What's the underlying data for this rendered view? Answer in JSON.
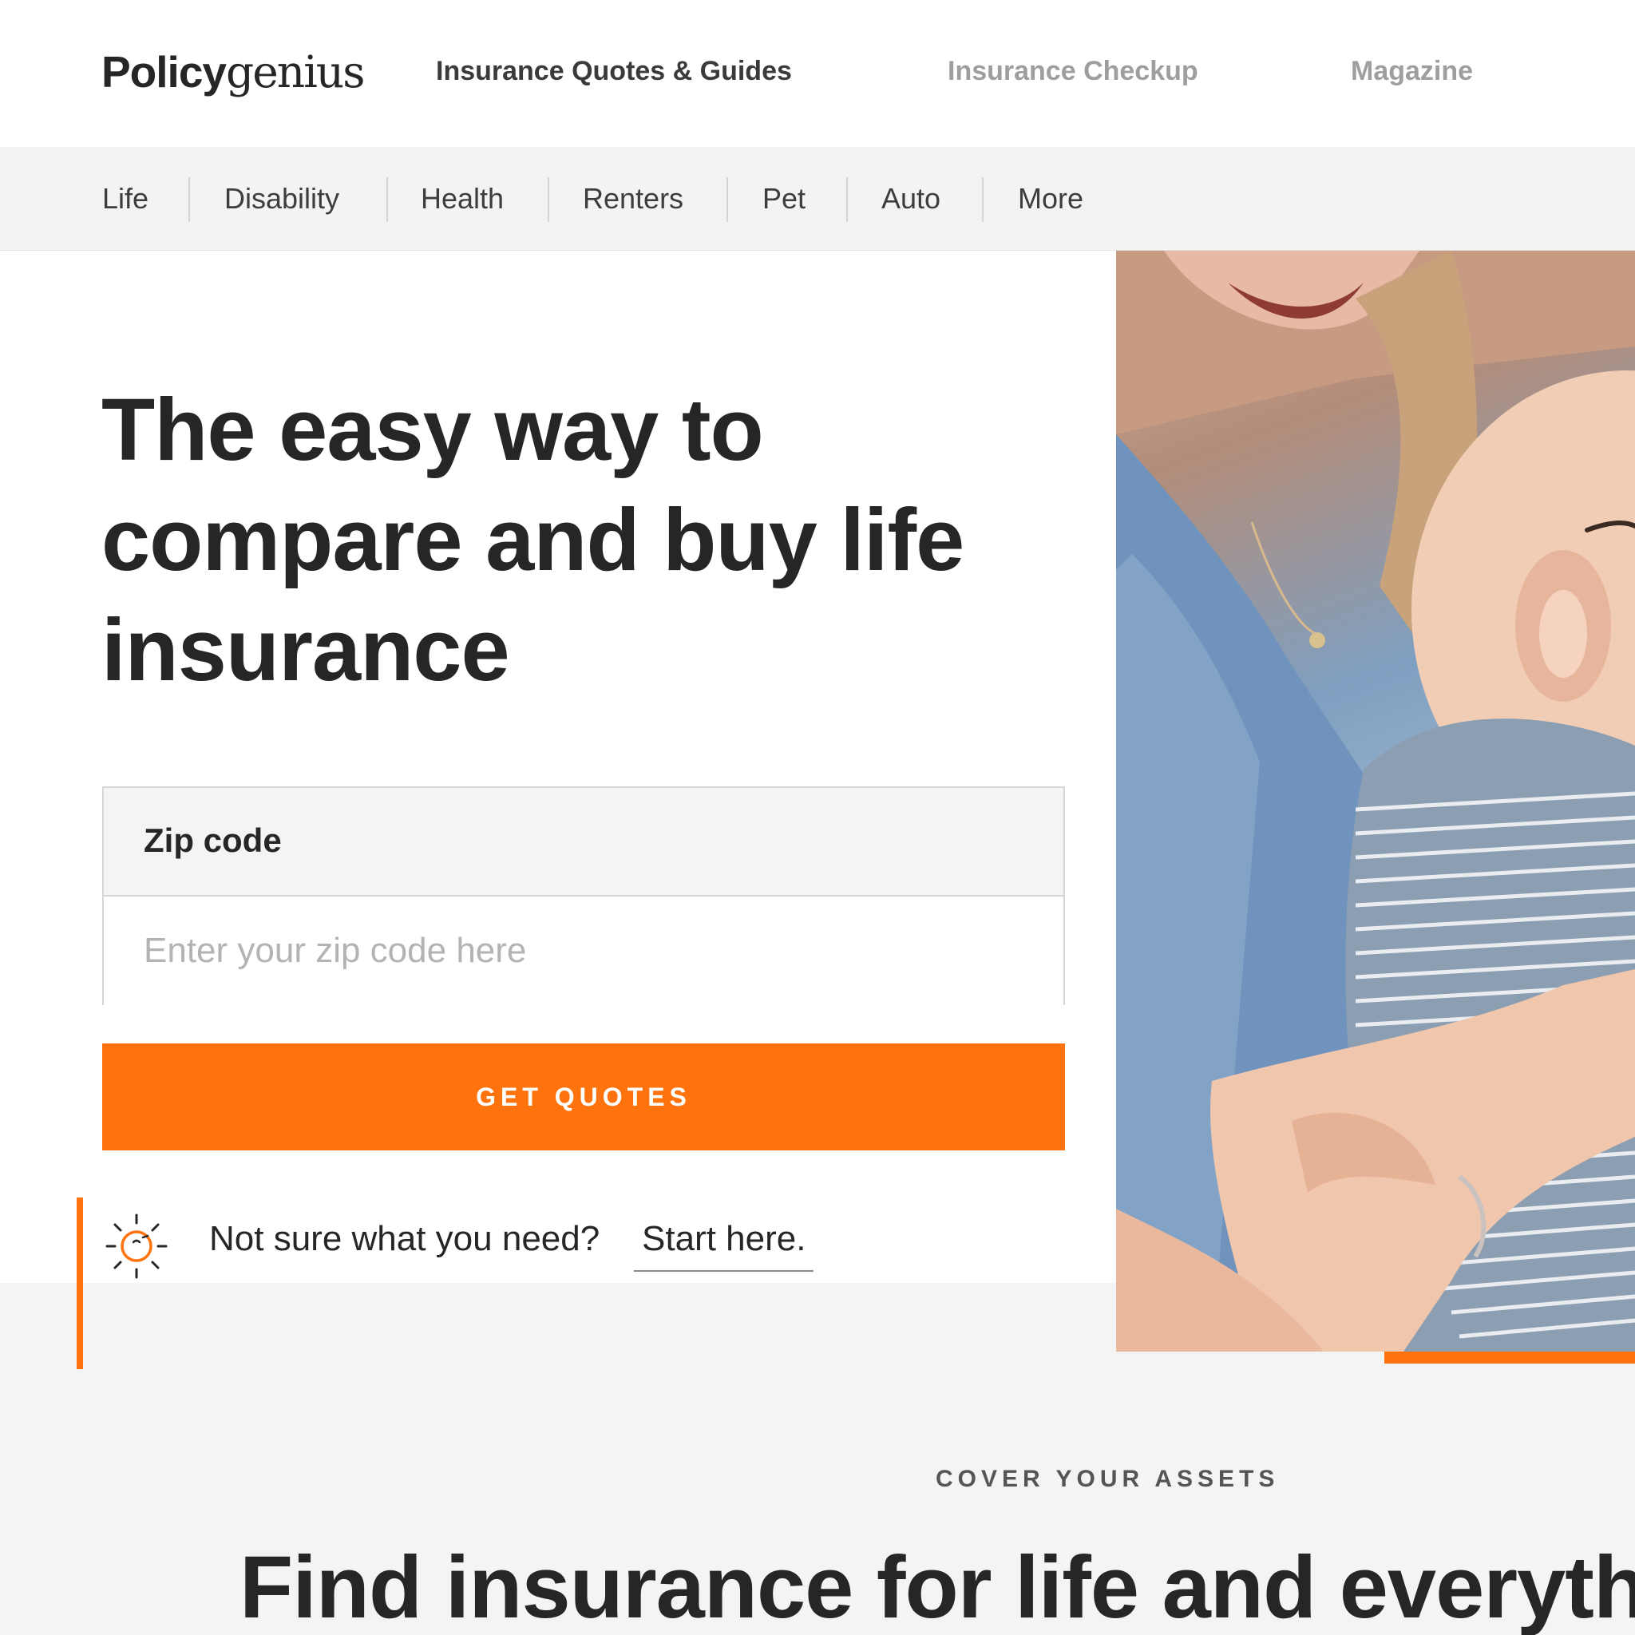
{
  "header": {
    "logo": {
      "bold": "Policy",
      "light": "genius"
    },
    "nav": [
      {
        "label": "Insurance Quotes & Guides",
        "active": true
      },
      {
        "label": "Insurance Checkup",
        "active": false
      },
      {
        "label": "Magazine",
        "active": false
      }
    ]
  },
  "subnav": {
    "items": [
      {
        "label": "Life"
      },
      {
        "label": "Disability"
      },
      {
        "label": "Health"
      },
      {
        "label": "Renters"
      },
      {
        "label": "Pet"
      },
      {
        "label": "Auto"
      },
      {
        "label": "More"
      }
    ]
  },
  "hero": {
    "headline": "The easy way to compare and buy life insurance",
    "zip": {
      "label": "Zip code",
      "placeholder": "Enter your zip code here",
      "value": ""
    },
    "cta_label": "GET QUOTES",
    "help": {
      "icon": "sun-face-icon",
      "text": "Not sure what you need?",
      "link": "Start here."
    },
    "image": "mother-holding-baby-photo"
  },
  "section": {
    "eyebrow": "COVER YOUR ASSETS",
    "title": "Find insurance for life and everythi"
  },
  "colors": {
    "accent": "#ff730f",
    "text": "#262626",
    "muted_nav": "#9e9e9e",
    "subnav_bg": "#f3f3f3",
    "band_bg": "#f4f4f4"
  }
}
